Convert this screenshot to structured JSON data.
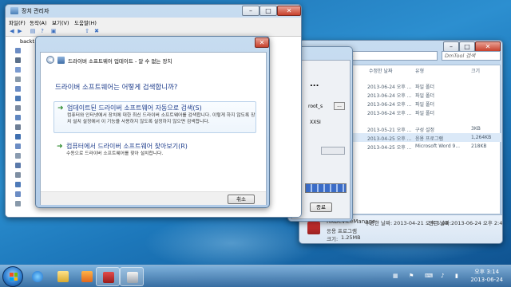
{
  "desktop": {
    "colors": {
      "bg": "#1c6fb0"
    }
  },
  "explorer": {
    "address": "« DmTool ▸",
    "search_placeholder": "DmTool 검색",
    "columns": {
      "date": "수정한 날짜",
      "type": "유형",
      "size": "크기"
    },
    "rows": [
      {
        "date": "2013-06-24 오후 ...",
        "type": "파일 폴더",
        "size": ""
      },
      {
        "date": "2013-06-24 오후 ...",
        "type": "파일 폴더",
        "size": ""
      },
      {
        "date": "2013-06-24 오후 ...",
        "type": "파일 폴더",
        "size": ""
      },
      {
        "date": "2013-06-24 오후 ...",
        "type": "파일 폴더",
        "size": ""
      },
      {
        "date": "2013-05-21 오후 ...",
        "type": "구성 설정",
        "size": "3KB"
      },
      {
        "date": "2013-04-25 오후 ...",
        "type": "응용 프로그램",
        "size": "1,264KB"
      },
      {
        "date": "2013-04-25 오후 ...",
        "type": "Microsoft Word 9...",
        "size": "218KB"
      }
    ],
    "details": {
      "name": "RKDeviceManage",
      "modified_label": "수정한 날짜:",
      "modified": "2013-04-21 오후 5:08",
      "created_label": "만든 날짜:",
      "created": "2013-06-24 오후 2:46",
      "type": "응용 프로그램",
      "size_label": "크기:",
      "size": "1.25MB"
    }
  },
  "tool": {
    "title": "...",
    "field_value": "root_s",
    "field_value2": "XXSI",
    "browse_label": "...",
    "ok_label": "종료"
  },
  "devmgr": {
    "title": "장치 관리자",
    "menu": [
      "파일(F)",
      "동작(A)",
      "보기(V)",
      "도움말(H)"
    ],
    "tree_root": "backt"
  },
  "dialog": {
    "title": "드라이버 소프트웨어 업데이트 - 알 수 없는 장치",
    "heading": "드라이버 소프트웨어는 어떻게 검색합니까?",
    "option1": {
      "title": "업데이트된 드라이버 소프트웨어 자동으로 검색(S)",
      "desc": "컴퓨터와 인터넷에서 장치에 대한 최신 드라이버 소프트웨어를 검색합니다. 이렇게 하지 않도록 장치 설치 설정에서 이 기능을 사용하지 않도록 설정하지 않으면 검색합니다."
    },
    "option2": {
      "title": "컴퓨터에서 드라이버 소프트웨어 찾아보기(R)",
      "desc": "수동으로 드라이버 소프트웨어를 찾아 설치합니다."
    },
    "cancel_label": "취소"
  },
  "taskbar": {
    "time": "오후 3:14",
    "date": "2013-06-24",
    "items": [
      "internet-explorer",
      "folder",
      "media-player",
      "device-tool",
      "printer"
    ]
  }
}
